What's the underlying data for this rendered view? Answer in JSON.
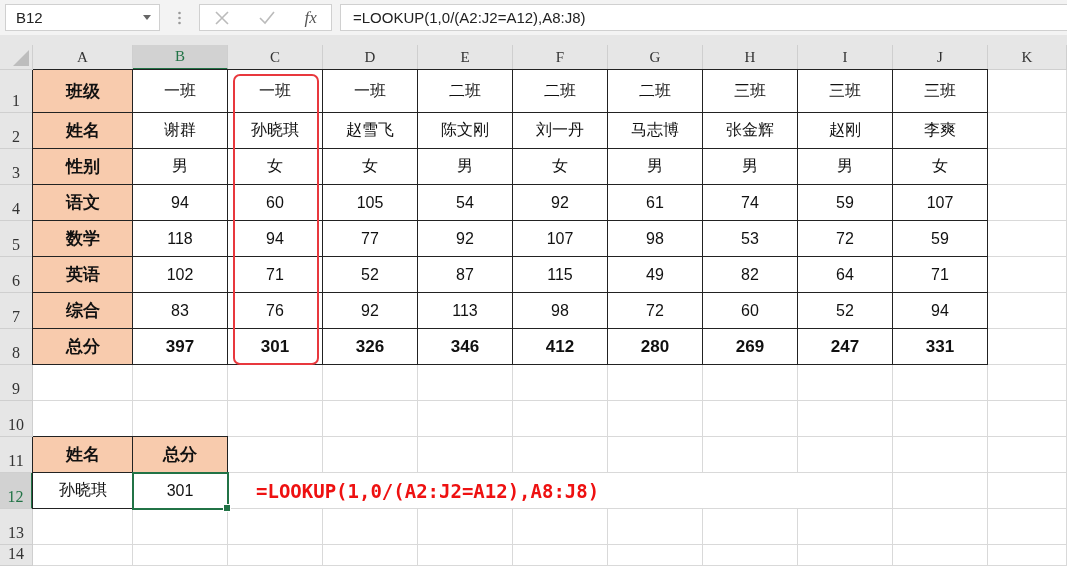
{
  "name_box": "B12",
  "function_label": "fx",
  "formula": "=LOOKUP(1,0/(A2:J2=A12),A8:J8)",
  "columns": [
    {
      "label": "A",
      "selected": false,
      "highlighted": false
    },
    {
      "label": "B",
      "selected": true,
      "highlighted": false
    },
    {
      "label": "C",
      "selected": false,
      "highlighted": true
    },
    {
      "label": "D",
      "selected": false,
      "highlighted": false
    },
    {
      "label": "E",
      "selected": false,
      "highlighted": false
    },
    {
      "label": "F",
      "selected": false,
      "highlighted": false
    },
    {
      "label": "G",
      "selected": false,
      "highlighted": false
    },
    {
      "label": "H",
      "selected": false,
      "highlighted": false
    },
    {
      "label": "I",
      "selected": false,
      "highlighted": false
    },
    {
      "label": "J",
      "selected": false,
      "highlighted": false
    },
    {
      "label": "K",
      "selected": false,
      "highlighted": false
    }
  ],
  "rows": [
    {
      "number": "1",
      "selected": false,
      "cells": [
        {
          "text": "班级",
          "kind": "header",
          "selected": false
        },
        {
          "text": "一班",
          "kind": "plain",
          "selected": false
        },
        {
          "text": "一班",
          "kind": "plain",
          "selected": false
        },
        {
          "text": "一班",
          "kind": "plain",
          "selected": false
        },
        {
          "text": "二班",
          "kind": "plain",
          "selected": false
        },
        {
          "text": "二班",
          "kind": "plain",
          "selected": false
        },
        {
          "text": "二班",
          "kind": "plain",
          "selected": false
        },
        {
          "text": "三班",
          "kind": "plain",
          "selected": false
        },
        {
          "text": "三班",
          "kind": "plain",
          "selected": false
        },
        {
          "text": "三班",
          "kind": "plain",
          "selected": false
        }
      ]
    },
    {
      "number": "2",
      "selected": false,
      "cells": [
        {
          "text": "姓名",
          "kind": "header",
          "selected": false
        },
        {
          "text": "谢群",
          "kind": "plain",
          "selected": false
        },
        {
          "text": "孙晓琪",
          "kind": "plain",
          "selected": false
        },
        {
          "text": "赵雪飞",
          "kind": "plain",
          "selected": false
        },
        {
          "text": "陈文刚",
          "kind": "plain",
          "selected": false
        },
        {
          "text": "刘一丹",
          "kind": "plain",
          "selected": false
        },
        {
          "text": "马志博",
          "kind": "plain",
          "selected": false
        },
        {
          "text": "张金辉",
          "kind": "plain",
          "selected": false
        },
        {
          "text": "赵刚",
          "kind": "plain",
          "selected": false
        },
        {
          "text": "李爽",
          "kind": "plain",
          "selected": false
        }
      ]
    },
    {
      "number": "3",
      "selected": false,
      "cells": [
        {
          "text": "性别",
          "kind": "header",
          "selected": false
        },
        {
          "text": "男",
          "kind": "plain",
          "selected": false
        },
        {
          "text": "女",
          "kind": "plain",
          "selected": false
        },
        {
          "text": "女",
          "kind": "plain",
          "selected": false
        },
        {
          "text": "男",
          "kind": "plain",
          "selected": false
        },
        {
          "text": "女",
          "kind": "plain",
          "selected": false
        },
        {
          "text": "男",
          "kind": "plain",
          "selected": false
        },
        {
          "text": "男",
          "kind": "plain",
          "selected": false
        },
        {
          "text": "男",
          "kind": "plain",
          "selected": false
        },
        {
          "text": "女",
          "kind": "plain",
          "selected": false
        }
      ]
    },
    {
      "number": "4",
      "selected": false,
      "cells": [
        {
          "text": "语文",
          "kind": "header",
          "selected": false
        },
        {
          "text": "94",
          "kind": "plain",
          "selected": false
        },
        {
          "text": "60",
          "kind": "plain",
          "selected": false
        },
        {
          "text": "105",
          "kind": "plain",
          "selected": false
        },
        {
          "text": "54",
          "kind": "plain",
          "selected": false
        },
        {
          "text": "92",
          "kind": "plain",
          "selected": false
        },
        {
          "text": "61",
          "kind": "plain",
          "selected": false
        },
        {
          "text": "74",
          "kind": "plain",
          "selected": false
        },
        {
          "text": "59",
          "kind": "plain",
          "selected": false
        },
        {
          "text": "107",
          "kind": "plain",
          "selected": false
        }
      ]
    },
    {
      "number": "5",
      "selected": false,
      "cells": [
        {
          "text": "数学",
          "kind": "header",
          "selected": false
        },
        {
          "text": "118",
          "kind": "plain",
          "selected": false
        },
        {
          "text": "94",
          "kind": "plain",
          "selected": false
        },
        {
          "text": "77",
          "kind": "plain",
          "selected": false
        },
        {
          "text": "92",
          "kind": "plain",
          "selected": false
        },
        {
          "text": "107",
          "kind": "plain",
          "selected": false
        },
        {
          "text": "98",
          "kind": "plain",
          "selected": false
        },
        {
          "text": "53",
          "kind": "plain",
          "selected": false
        },
        {
          "text": "72",
          "kind": "plain",
          "selected": false
        },
        {
          "text": "59",
          "kind": "plain",
          "selected": false
        }
      ]
    },
    {
      "number": "6",
      "selected": false,
      "cells": [
        {
          "text": "英语",
          "kind": "header",
          "selected": false
        },
        {
          "text": "102",
          "kind": "plain",
          "selected": false
        },
        {
          "text": "71",
          "kind": "plain",
          "selected": false
        },
        {
          "text": "52",
          "kind": "plain",
          "selected": false
        },
        {
          "text": "87",
          "kind": "plain",
          "selected": false
        },
        {
          "text": "115",
          "kind": "plain",
          "selected": false
        },
        {
          "text": "49",
          "kind": "plain",
          "selected": false
        },
        {
          "text": "82",
          "kind": "plain",
          "selected": false
        },
        {
          "text": "64",
          "kind": "plain",
          "selected": false
        },
        {
          "text": "71",
          "kind": "plain",
          "selected": false
        }
      ]
    },
    {
      "number": "7",
      "selected": false,
      "cells": [
        {
          "text": "综合",
          "kind": "header",
          "selected": false
        },
        {
          "text": "83",
          "kind": "plain",
          "selected": false
        },
        {
          "text": "76",
          "kind": "plain",
          "selected": false
        },
        {
          "text": "92",
          "kind": "plain",
          "selected": false
        },
        {
          "text": "113",
          "kind": "plain",
          "selected": false
        },
        {
          "text": "98",
          "kind": "plain",
          "selected": false
        },
        {
          "text": "72",
          "kind": "plain",
          "selected": false
        },
        {
          "text": "60",
          "kind": "plain",
          "selected": false
        },
        {
          "text": "52",
          "kind": "plain",
          "selected": false
        },
        {
          "text": "94",
          "kind": "plain",
          "selected": false
        }
      ]
    },
    {
      "number": "8",
      "selected": false,
      "cells": [
        {
          "text": "总分",
          "kind": "header",
          "selected": false
        },
        {
          "text": "397",
          "kind": "bold",
          "selected": false
        },
        {
          "text": "301",
          "kind": "bold",
          "selected": false
        },
        {
          "text": "326",
          "kind": "bold",
          "selected": false
        },
        {
          "text": "346",
          "kind": "bold",
          "selected": false
        },
        {
          "text": "412",
          "kind": "bold",
          "selected": false
        },
        {
          "text": "280",
          "kind": "bold",
          "selected": false
        },
        {
          "text": "269",
          "kind": "bold",
          "selected": false
        },
        {
          "text": "247",
          "kind": "bold",
          "selected": false
        },
        {
          "text": "331",
          "kind": "bold",
          "selected": false
        }
      ]
    },
    {
      "number": "9",
      "selected": false,
      "cells": []
    },
    {
      "number": "10",
      "selected": false,
      "cells": []
    },
    {
      "number": "11",
      "selected": false,
      "cells": [
        {
          "text": "姓名",
          "kind": "header",
          "selected": false
        },
        {
          "text": "总分",
          "kind": "header",
          "selected": false
        }
      ]
    },
    {
      "number": "12",
      "selected": true,
      "cells": [
        {
          "text": "孙晓琪",
          "kind": "plain",
          "selected": false
        },
        {
          "text": "301",
          "kind": "plain",
          "selected": true
        }
      ],
      "annotation": "=LOOKUP(1,0/(A2:J2=A12),A8:J8)"
    },
    {
      "number": "13",
      "selected": false,
      "cells": []
    },
    {
      "number": "14",
      "selected": false,
      "cells": []
    }
  ]
}
